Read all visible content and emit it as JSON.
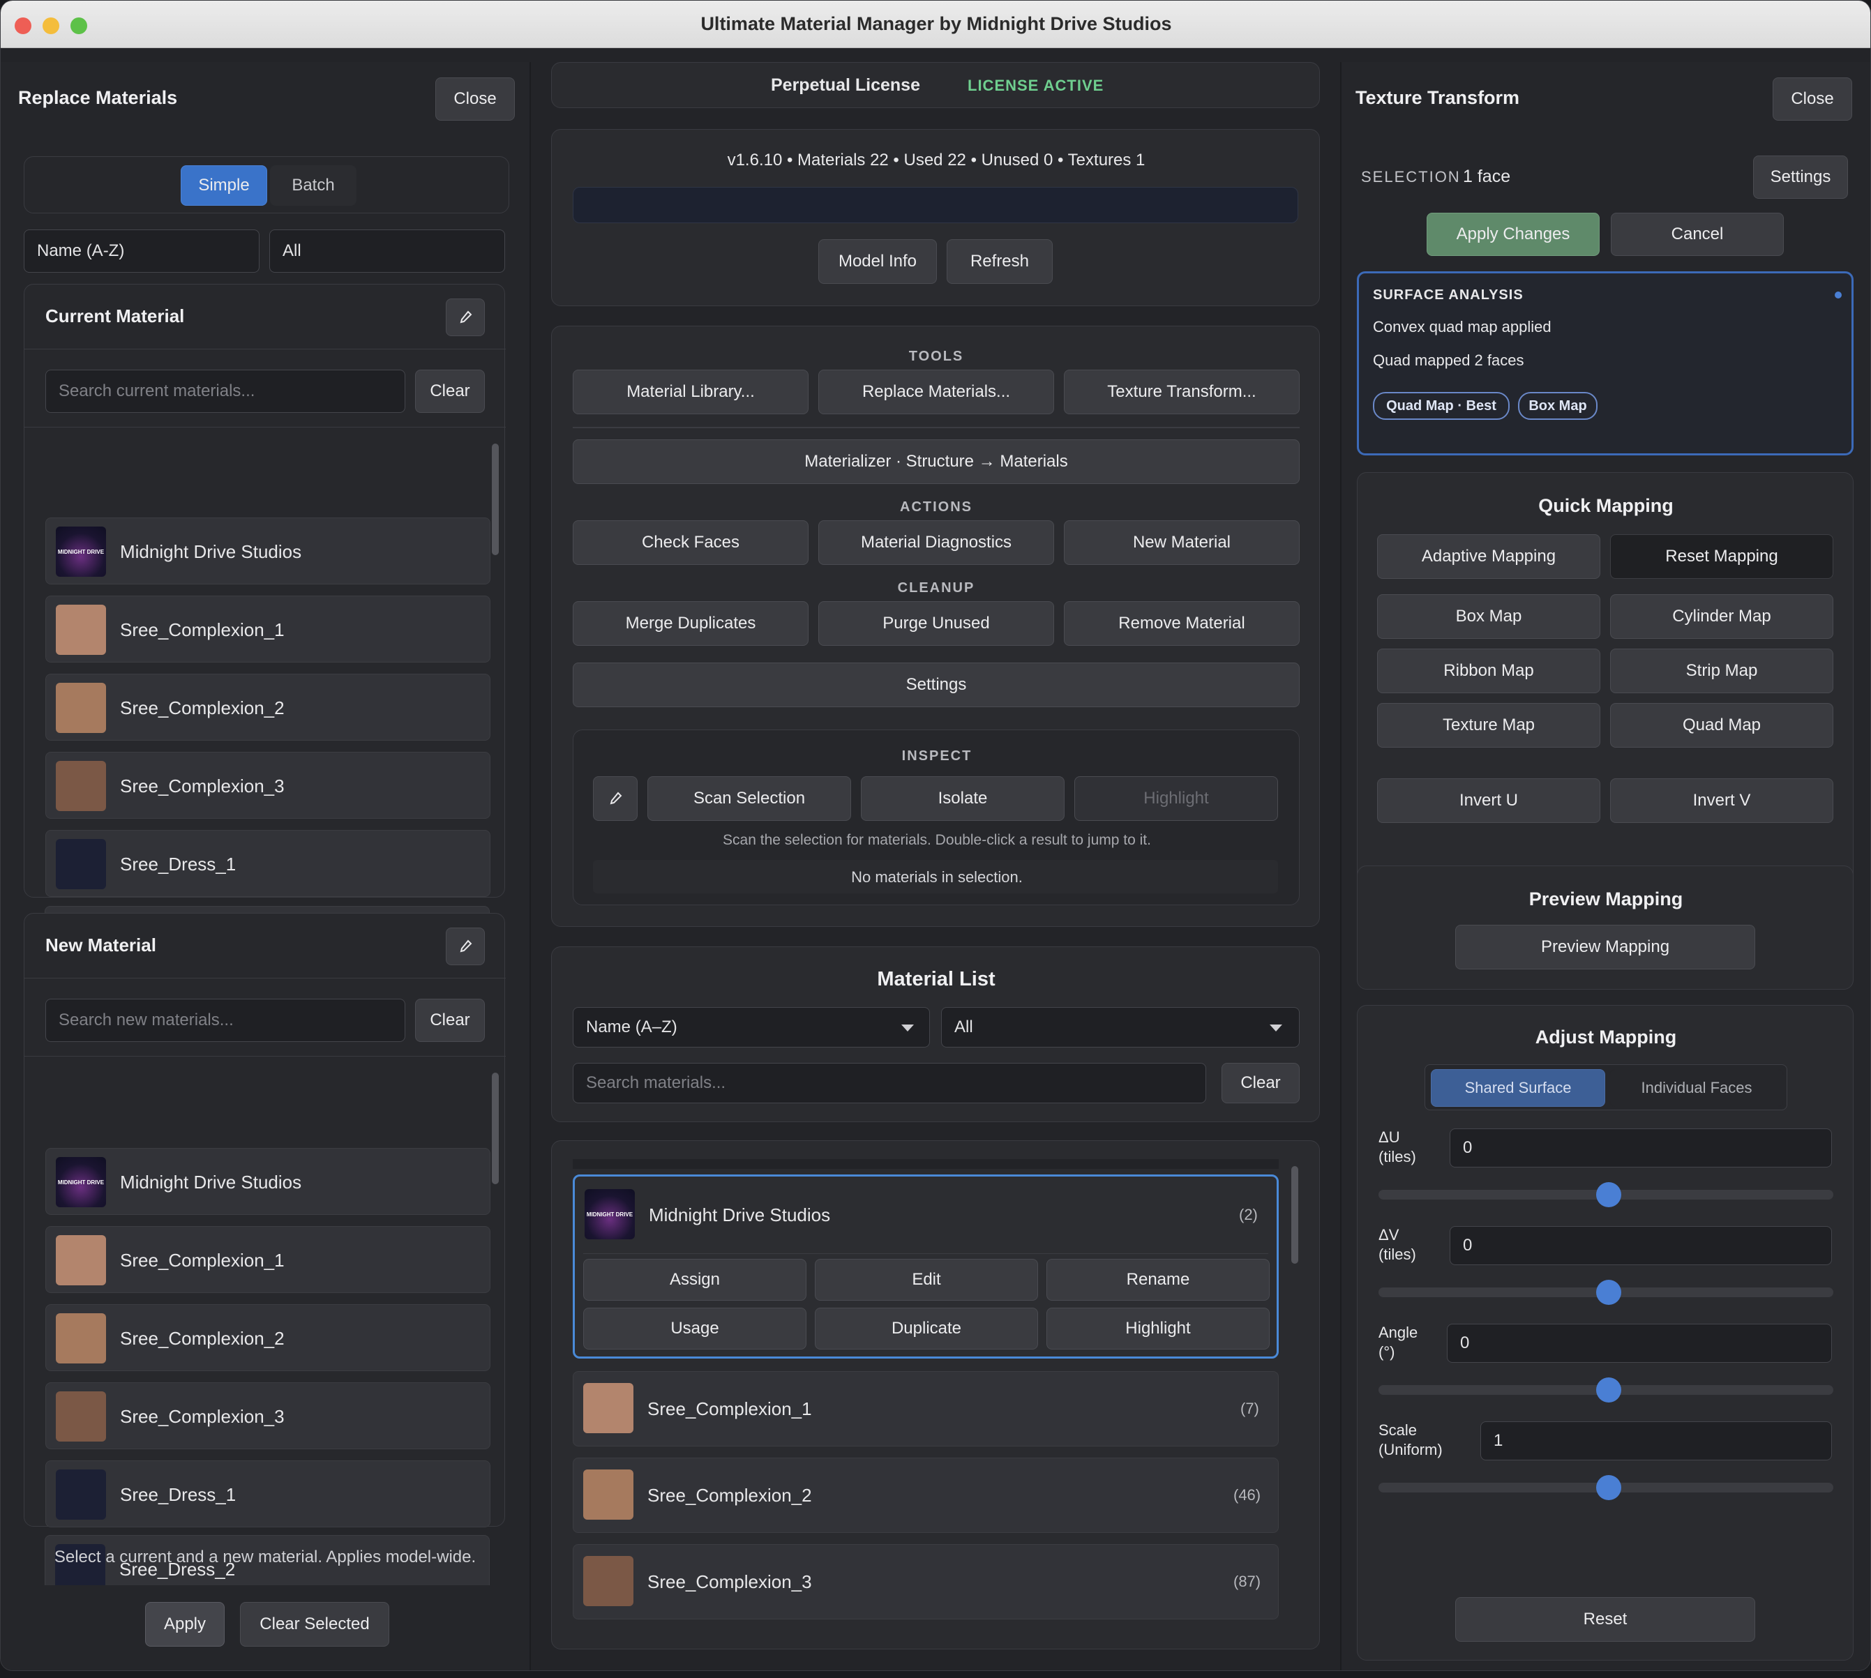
{
  "window": {
    "title": "Ultimate Material Manager by Midnight Drive Studios"
  },
  "replace": {
    "title": "Replace Materials",
    "close": "Close",
    "mode_simple": "Simple",
    "mode_batch": "Batch",
    "sort": "Name (A-Z)",
    "filter": "All",
    "current_title": "Current Material",
    "current_search_ph": "Search current materials...",
    "new_title": "New Material",
    "new_search_ph": "Search new materials...",
    "clear": "Clear",
    "items": [
      "Midnight Drive Studios",
      "Sree_Complexion_1",
      "Sree_Complexion_2",
      "Sree_Complexion_3",
      "Sree_Dress_1",
      "Sree_Dress_2"
    ],
    "hint": "Select a current and a new material. Applies model-wide.",
    "apply": "Apply",
    "clear_selected": "Clear Selected",
    "logo_text": "MIDNIGHT DRIVE"
  },
  "center": {
    "license": "Perpetual License",
    "license_status": "LICENSE ACTIVE",
    "stats": "v1.6.10 • Materials 22 • Used 22 • Unused 0 • Textures 1",
    "model_info": "Model Info",
    "refresh": "Refresh",
    "tools_label": "TOOLS",
    "material_library": "Material Library...",
    "replace_materials": "Replace Materials...",
    "texture_transform": "Texture Transform...",
    "materializer": "Materializer · Structure → Materials",
    "actions_label": "ACTIONS",
    "check_faces": "Check Faces",
    "material_diagnostics": "Material Diagnostics",
    "new_material": "New Material",
    "cleanup_label": "CLEANUP",
    "merge_duplicates": "Merge Duplicates",
    "purge_unused": "Purge Unused",
    "remove_material": "Remove Material",
    "settings": "Settings",
    "inspect_label": "INSPECT",
    "scan_selection": "Scan Selection",
    "isolate": "Isolate",
    "highlight": "Highlight",
    "inspect_hint": "Scan the selection for materials. Double-click a result to jump to it.",
    "no_materials": "No materials in selection.",
    "list_title": "Material List",
    "list_sort": "Name (A–Z)",
    "list_filter": "All",
    "list_search_ph": "Search materials...",
    "list_clear": "Clear",
    "selected_item": {
      "name": "Midnight Drive Studios",
      "count": "(2)"
    },
    "item_actions": [
      "Assign",
      "Edit",
      "Rename",
      "Usage",
      "Duplicate",
      "Highlight"
    ],
    "list_items": [
      {
        "name": "Sree_Complexion_1",
        "count": "(7)"
      },
      {
        "name": "Sree_Complexion_2",
        "count": "(46)"
      },
      {
        "name": "Sree_Complexion_3",
        "count": "(87)"
      }
    ]
  },
  "texture": {
    "title": "Texture Transform",
    "close": "Close",
    "selection_label": "SELECTION",
    "selection_value": "1 face",
    "settings": "Settings",
    "apply_changes": "Apply Changes",
    "cancel": "Cancel",
    "analysis_title": "SURFACE ANALYSIS",
    "analysis_line1": "Convex quad map applied",
    "analysis_line2": "Quad mapped 2 faces",
    "tag_best": "Quad Map · Best",
    "tag_box": "Box Map",
    "quick_title": "Quick Mapping",
    "adaptive": "Adaptive Mapping",
    "reset_mapping": "Reset Mapping",
    "box_map": "Box Map",
    "cylinder_map": "Cylinder Map",
    "ribbon_map": "Ribbon Map",
    "strip_map": "Strip Map",
    "texture_map": "Texture Map",
    "quad_map": "Quad Map",
    "invert_u": "Invert U",
    "invert_v": "Invert V",
    "preview_title": "Preview Mapping",
    "preview_btn": "Preview Mapping",
    "adjust_title": "Adjust Mapping",
    "shared_surface": "Shared Surface",
    "individual_faces": "Individual Faces",
    "du_label1": "ΔU",
    "du_label2": "(tiles)",
    "du_value": "0",
    "dv_label1": "ΔV",
    "dv_label2": "(tiles)",
    "dv_value": "0",
    "angle_label1": "Angle",
    "angle_label2": "(°)",
    "angle_value": "0",
    "scale_label1": "Scale",
    "scale_label2": "(Uniform)",
    "scale_value": "1",
    "reset": "Reset"
  },
  "colors": {
    "accent_blue": "#4a7fd4",
    "license_green": "#6fcf8f",
    "apply_green": "#5f8a6a",
    "complexion_1": "#b3856d",
    "complexion_2": "#a67a5e",
    "complexion_3": "#7b5846",
    "dress": "#1c2034"
  }
}
